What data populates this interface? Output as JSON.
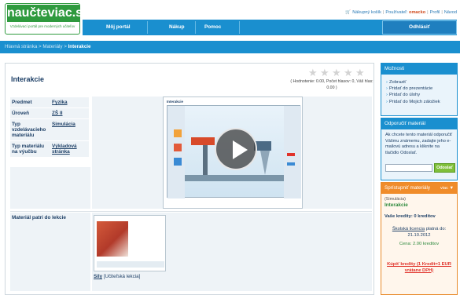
{
  "brand": {
    "name": "naučteviac.sk",
    "slogan": "Vzdelávací portál pre moderných učiteľov"
  },
  "topbar": {
    "cart": "Nákupný košík",
    "user_prefix": "Používateľ:",
    "user": "omacko",
    "profile": "Profil",
    "help": "Návod"
  },
  "nav": {
    "items": [
      "Môj portál",
      "Nákup",
      "Pomoc"
    ],
    "logout": "Odhlásiť"
  },
  "breadcrumb": {
    "home": "Hlavná stránka",
    "materials": "Materiály",
    "current": "Interakcie",
    "sep": ">"
  },
  "page": {
    "title": "Interakcie",
    "rating_text": "( Hodnotenie: 0.00, Počet hlasov: 0, Váš hlas: 0.00 )",
    "stars": 5,
    "rating_value": 0
  },
  "info": {
    "rows": [
      {
        "key": "Predmet",
        "value": "Fyzika"
      },
      {
        "key": "Úroveň",
        "value": "ZŠ II"
      },
      {
        "key": "Typ vzdelávacieho materiálu",
        "value": "Simulácia"
      },
      {
        "key": "Typ materiálu na výučbu",
        "value": "Výkladová stránka"
      }
    ]
  },
  "preview": {
    "caption": "Interakcie"
  },
  "lesson": {
    "label": "Materiál patrí do lekcie",
    "link": "Sily",
    "link_suffix": "[Učiteľská lekcia]"
  },
  "sidebar": {
    "options": {
      "title": "Možnosti",
      "items": [
        "Zobraziť",
        "Pridať do prezentácie",
        "Pridať do úlohy",
        "Pridať do Mojich záložiek"
      ]
    },
    "recommend": {
      "title": "Odporučiť materiál",
      "text": "Ak chcete tento materiál odporučiť Vášmu známemu, zadajte jeho e-mailovú adresu a kliknite na tlačidlo Odoslať.",
      "button": "Odoslať",
      "email_value": ""
    },
    "unlock": {
      "title": "Sprístupniť materiály",
      "more": "viac",
      "type": "(Simulácia)",
      "name": "Interakcie",
      "credits": "Vaše kredity: 0 kreditov",
      "license_link": "Školská licencia",
      "license_text": "platná do: 21.10.2012",
      "price": "Cena: 2.00 kreditov",
      "buy": "Kúpiť kredity (1 Kredit=1 EUR vrátane DPH)"
    }
  },
  "colors": {
    "brand_green": "#2f9a3e",
    "nav_blue": "#1a8fcf",
    "accent_orange": "#f08c2a",
    "link_red": "#e0322a"
  }
}
